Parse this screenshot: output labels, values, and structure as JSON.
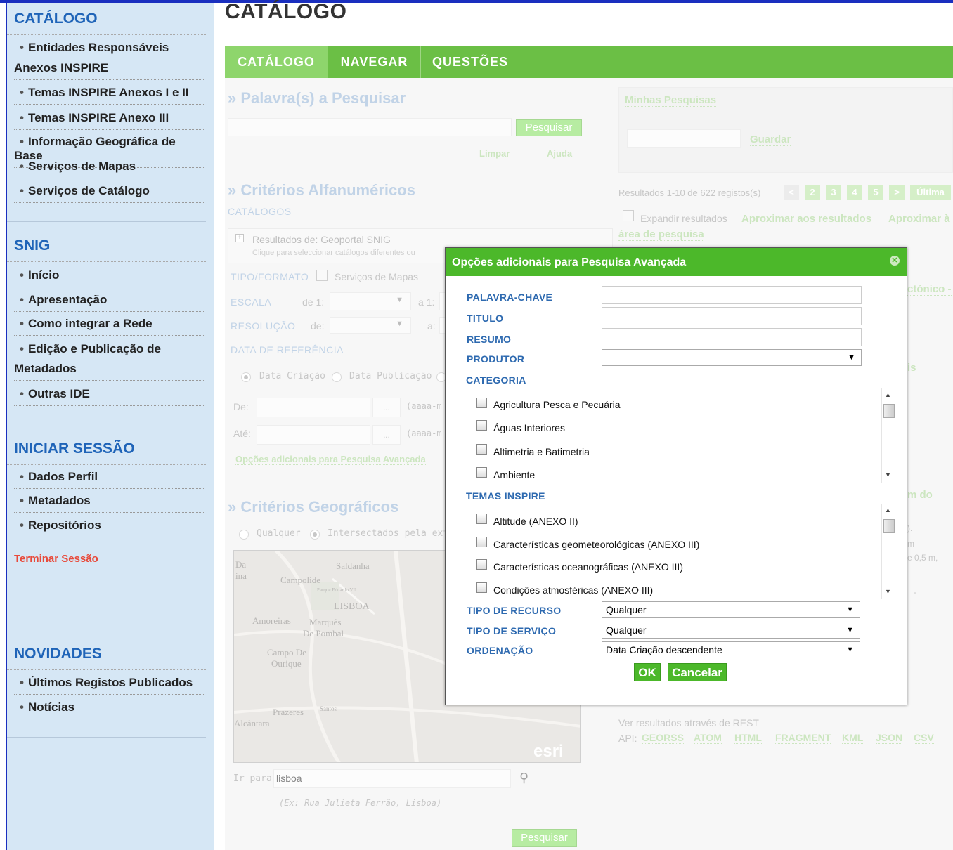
{
  "sidebar": {
    "catalogo": {
      "heading": "CATÁLOGO",
      "items": [
        "Entidades Responsáveis",
        "Anexos INSPIRE",
        "Temas INSPIRE Anexos I e II",
        "Temas INSPIRE Anexo III",
        "Informação Geográfica de Base",
        "Serviços de Mapas",
        "Serviços de Catálogo"
      ]
    },
    "snig": {
      "heading": "SNIG",
      "items": [
        "Início",
        "Apresentação",
        "Como integrar a Rede",
        "Edição e Publicação de",
        "Metadados",
        "Outras IDE"
      ]
    },
    "sessao": {
      "heading": "INICIAR SESSÃO",
      "items": [
        "Dados Perfil",
        "Metadados",
        "Repositórios"
      ],
      "logout": "Terminar Sessão"
    },
    "novidades": {
      "heading": "NOVIDADES",
      "items": [
        "Últimos Registos Publicados",
        "Notícias"
      ]
    }
  },
  "main": {
    "title": "CATÁLOGO",
    "tabs": [
      "CATÁLOGO",
      "NAVEGAR",
      "QUESTÕES"
    ]
  },
  "search": {
    "heading": "» Palavra(s) a Pesquisar",
    "button": "Pesquisar",
    "clear": "Limpar",
    "help": "Ajuda"
  },
  "my_searches": {
    "title": "Minhas Pesquisas",
    "save": "Guardar"
  },
  "results": {
    "summary": "Resultados 1-10 de 622 registos(s)",
    "pages": [
      "<",
      "2",
      "3",
      "4",
      "5",
      ">",
      "Última"
    ],
    "expand": "Expandir resultados",
    "zoom_results": "Aproximar aos resultados",
    "zoom_area": "Aproximar à",
    "zoom_area_2": "área de pesquisa",
    "partial_1": "ctónico -",
    "partial_2": "is",
    "partial_3": "m do",
    "partial_4": ").",
    "partial_5": "m",
    "partial_6": "e 0,5 m,",
    "partial_7": "-",
    "rest": "Ver resultados através de REST",
    "api_label": "API:",
    "api_links": [
      "GEORSS",
      "ATOM",
      "HTML",
      "FRAGMENT",
      "KML",
      "JSON",
      "CSV"
    ]
  },
  "alfa": {
    "heading": "» Critérios Alfanuméricos",
    "catalogs_label": "CATÁLOGOS",
    "results_from": "Resultados de: Geoportal SNIG",
    "click_hint": "Clique para seleccionar catálogos diferentes ou",
    "tipo_label": "TIPO/FORMATO",
    "tipo_option": "Serviços de Mapas",
    "escala_label": "ESCALA",
    "escala_de": "de 1:",
    "escala_a": "a 1:",
    "resolucao_label": "RESOLUÇÃO",
    "res_de": "de:",
    "res_a": "a:",
    "data_label": "DATA DE REFERÊNCIA",
    "data_criacao": "Data Criação",
    "data_publicacao": "Data Publicação",
    "de": "De:",
    "ate": "Até:",
    "date_btn": "...",
    "date_hint": "(aaaa-m",
    "advanced_link": "Opções adicionais para Pesquisa Avançada"
  },
  "geo": {
    "heading": "» Critérios Geográficos",
    "any": "Qualquer",
    "intersect": "Intersectados pela exter",
    "goto_label": "Ir para:",
    "goto_value": "lisboa",
    "example": "(Ex: Rua Julieta Ferrão, Lisboa)",
    "search_btn": "Pesquisar",
    "map_labels": [
      "Da",
      "ina",
      "Saldanha",
      "Campolide",
      "Parque Eduardo VII",
      "LISBOA",
      "Amoreiras",
      "Marquês",
      "De Pombal",
      "Campo De",
      "Ourique",
      "Prazeres",
      "Alcântara",
      "Santos",
      "esri"
    ]
  },
  "modal": {
    "title": "Opções adicionais para Pesquisa Avançada",
    "keyword_label": "PALAVRA-CHAVE",
    "title_label": "TITULO",
    "abstract_label": "RESUMO",
    "producer_label": "PRODUTOR",
    "category_label": "CATEGORIA",
    "categories": [
      "Agricultura Pesca e Pecuária",
      "Águas Interiores",
      "Altimetria e Batimetria",
      "Ambiente"
    ],
    "inspire_label": "TEMAS INSPIRE",
    "inspire_themes": [
      "Altitude (ANEXO II)",
      "Características geometeorológicas (ANEXO III)",
      "Características oceanográficas (ANEXO III)",
      "Condições atmosféricas (ANEXO III)"
    ],
    "resource_type_label": "TIPO DE RECURSO",
    "resource_type_value": "Qualquer",
    "service_type_label": "TIPO DE SERVIÇO",
    "service_type_value": "Qualquer",
    "order_label": "ORDENAÇÃO",
    "order_value": "Data Criação descendente",
    "ok": "OK",
    "cancel": "Cancelar"
  },
  "colors": {
    "accent": "#4cb82a",
    "link_blue": "#1f64b8",
    "sidebar_bg": "#d6e7f5"
  }
}
